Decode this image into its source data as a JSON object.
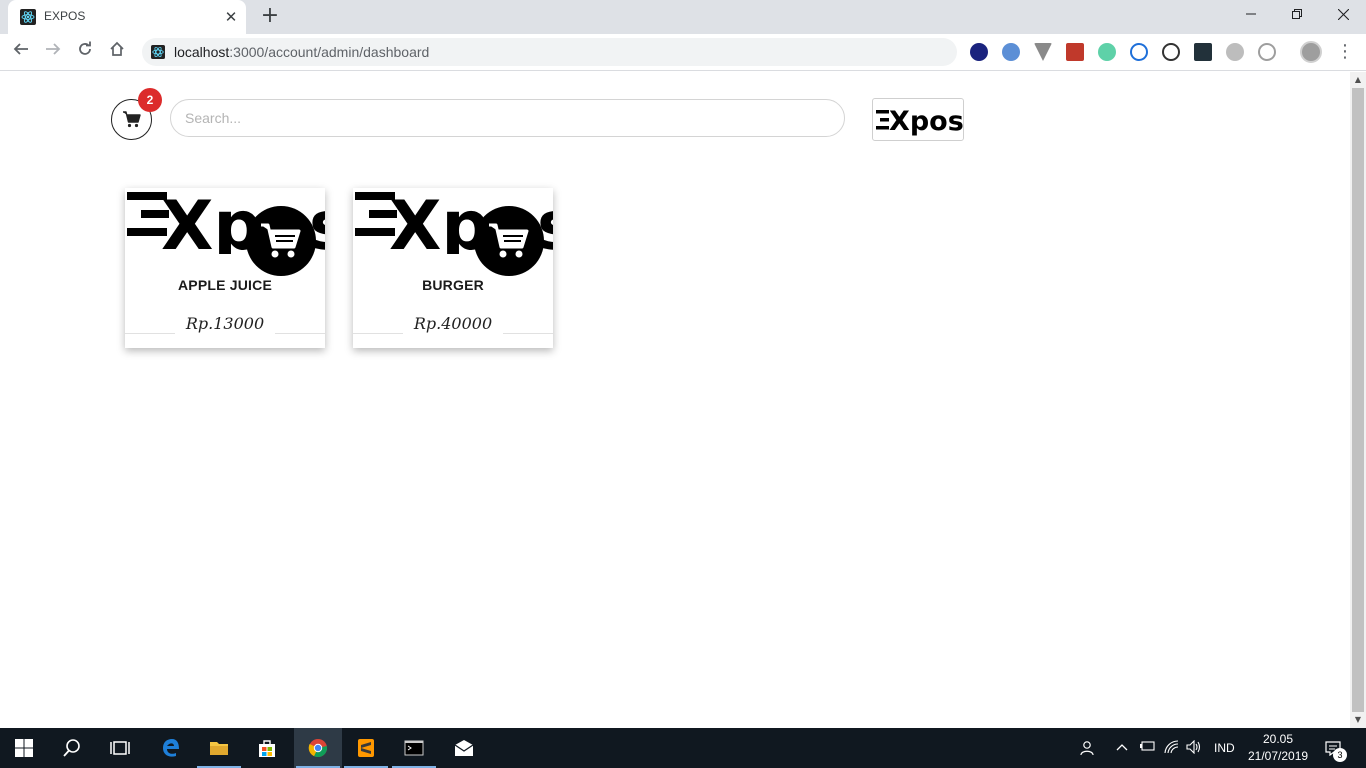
{
  "browser": {
    "tab_title": "EXPOS",
    "url_host": "localhost",
    "url_path": ":3000/account/admin/dashboard",
    "new_tab_glyph": "+",
    "close_glyph": "✕"
  },
  "page": {
    "cart_count": "2",
    "search_placeholder": "Search...",
    "logo_text": "Xpos",
    "products": [
      {
        "name": "APPLE JUICE",
        "price": "Rp.13000",
        "logo_text": "Xpos"
      },
      {
        "name": "BURGER",
        "price": "Rp.40000",
        "logo_text": "Xpos"
      }
    ]
  },
  "taskbar": {
    "language": "IND",
    "time": "20.05",
    "date": "21/07/2019",
    "notifications": "3"
  },
  "colors": {
    "badge": "#dc2b2b",
    "taskbar": "#101820",
    "chrome_frame": "#dee1e6"
  }
}
